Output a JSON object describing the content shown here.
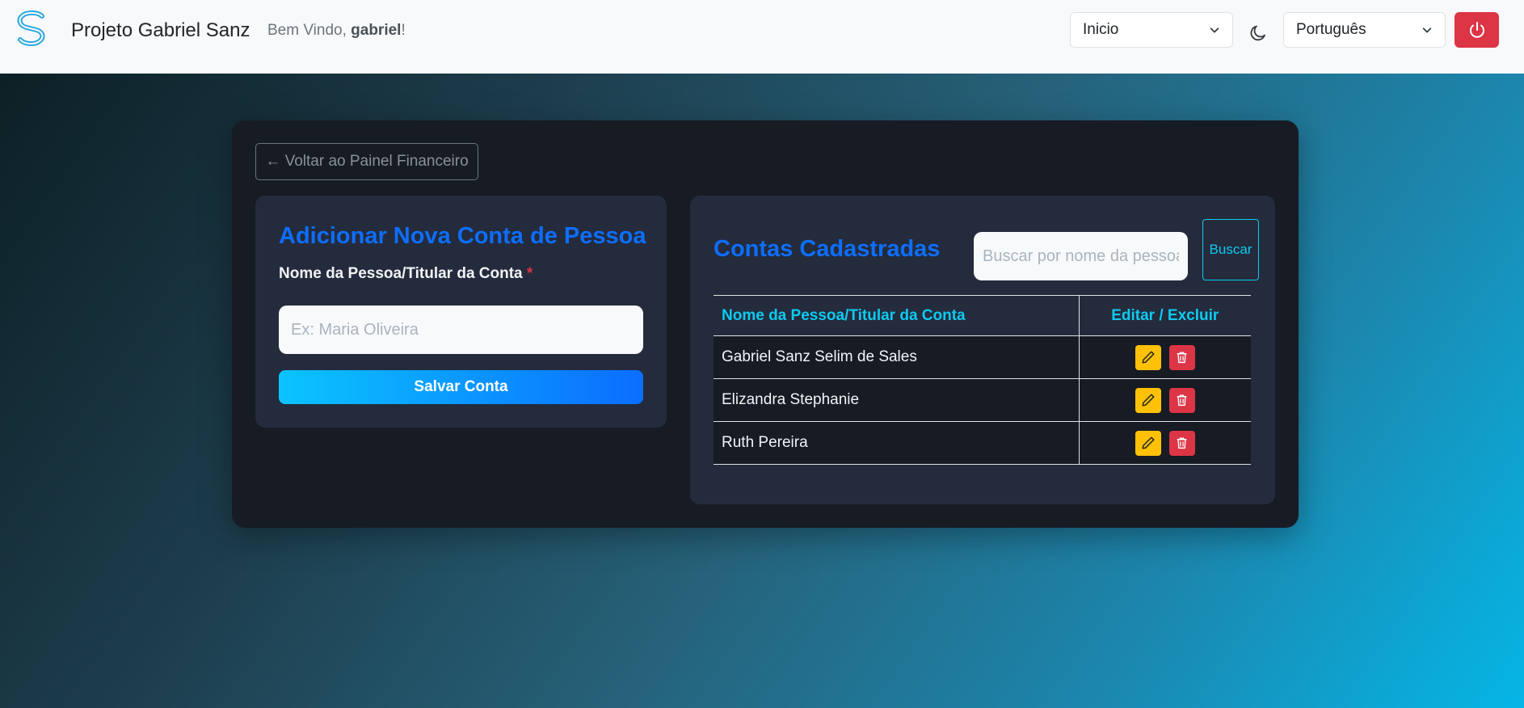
{
  "header": {
    "brand": "Projeto Gabriel Sanz",
    "welcome_prefix": "Bem Vindo, ",
    "username": "gabriel",
    "welcome_suffix": "!",
    "page_select": "Inicio",
    "language_select": "Português"
  },
  "back_button": "← Voltar ao Painel Financeiro",
  "add_form": {
    "title": "Adicionar Nova Conta de Pessoa",
    "label": "Nome da Pessoa/Titular da Conta",
    "required_mark": "*",
    "placeholder": "Ex: Maria Oliveira",
    "save_label": "Salvar Conta"
  },
  "accounts": {
    "title": "Contas Cadastradas",
    "search_placeholder": "Buscar por nome da pessoa",
    "search_button": "Buscar",
    "col_name": "Nome da Pessoa/Titular da Conta",
    "col_actions": "Editar / Excluir",
    "rows": [
      "Gabriel Sanz Selim de Sales",
      "Elizandra Stephanie",
      "Ruth Pereira"
    ]
  },
  "colors": {
    "accent": "#0d6efd",
    "info": "#0dcaf0",
    "danger": "#dc3545",
    "warning": "#ffc107"
  },
  "icons": [
    "logo-icon",
    "chevron-down-icon",
    "moon-icon",
    "power-icon",
    "pencil-icon",
    "trash-icon"
  ]
}
